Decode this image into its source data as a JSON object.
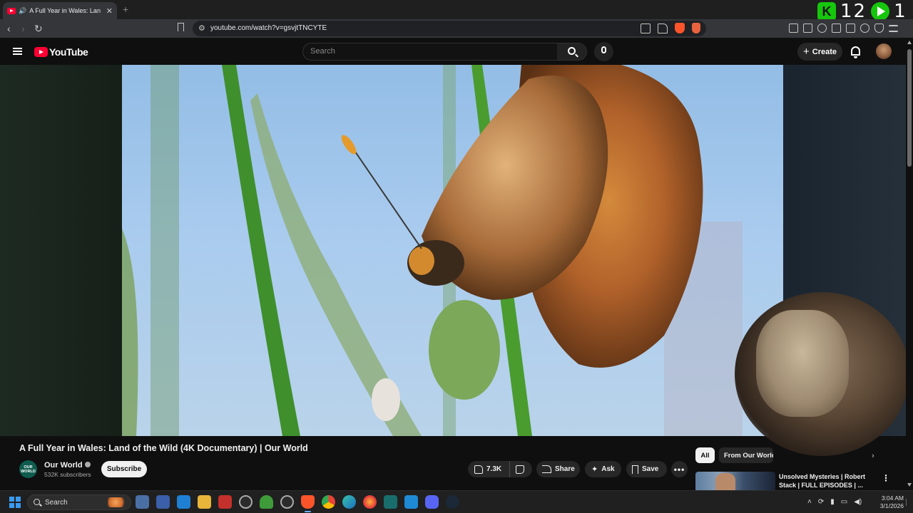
{
  "browser": {
    "tab_title": "A Full Year in Wales: Land of the Wild",
    "url": "youtube.com/watch?v=gsvjtTNCYTE",
    "overlay_counter_left": "12",
    "overlay_counter_right": "1"
  },
  "header": {
    "logo_text": "YouTube",
    "search_placeholder": "Search",
    "create_label": "Create"
  },
  "video": {
    "title": "A Full Year in Wales: Land of the Wild (4K Documentary) | Our World",
    "channel_name": "Our World",
    "channel_avatar_text": "OUR WORLD",
    "subscribers": "532K subscribers",
    "subscribe_label": "Subscribe",
    "likes": "7.3K",
    "share_label": "Share",
    "ask_label": "Ask",
    "save_label": "Save"
  },
  "sidebar": {
    "chips": [
      "All",
      "From Our World"
    ],
    "recommendation_title": "Unsolved Mysteries | Robert Stack | FULL EPISODES | ..."
  },
  "taskbar": {
    "search_label": "Search",
    "time": "3:04 AM",
    "date": "3/1/2026"
  },
  "colors": {
    "youtube_red": "#ff0033",
    "background": "#0f0f0f",
    "accent_green": "#16c60c"
  }
}
